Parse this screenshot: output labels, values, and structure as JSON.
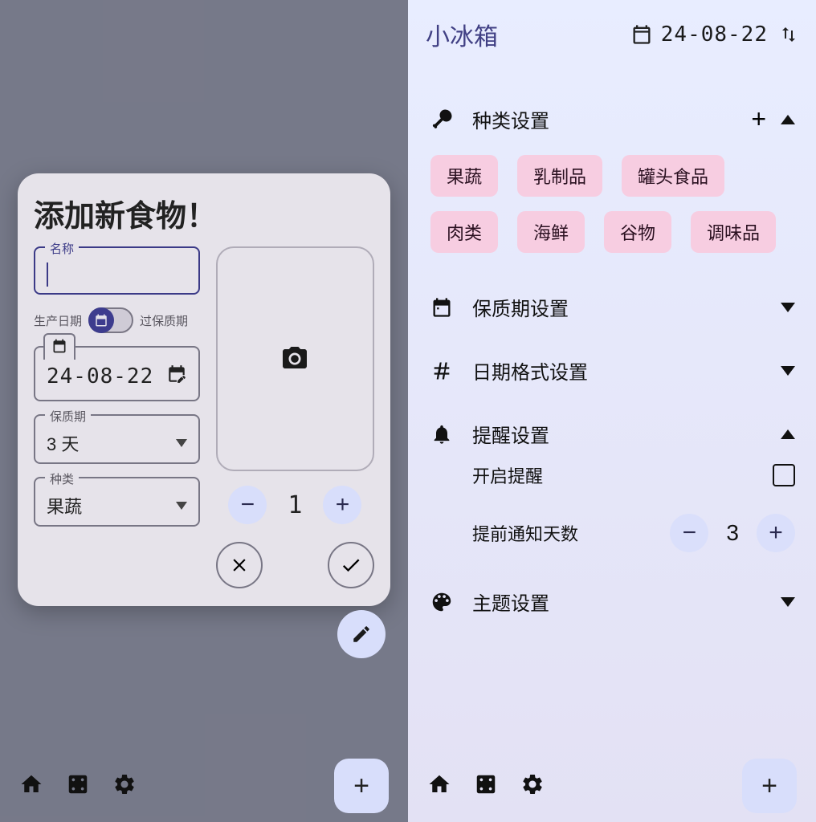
{
  "app_title": "小冰箱",
  "header_date": "24-08-22",
  "modal": {
    "title": "添加新食物！",
    "name_label": "名称",
    "name_value": "",
    "toggle_left": "生产日期",
    "toggle_right": "过保质期",
    "date_value": "24-08-22",
    "shelf_label": "保质期",
    "shelf_value": "3 天",
    "category_label": "种类",
    "category_value": "果蔬",
    "quantity": "1"
  },
  "settings": {
    "categories": {
      "title": "种类设置",
      "items": [
        "果蔬",
        "乳制品",
        "罐头食品",
        "肉类",
        "海鲜",
        "谷物",
        "调味品"
      ]
    },
    "shelf": {
      "title": "保质期设置"
    },
    "datefmt": {
      "title": "日期格式设置"
    },
    "reminder": {
      "title": "提醒设置",
      "enable_label": "开启提醒",
      "enable_checked": false,
      "advance_label": "提前通知天数",
      "advance_days": "3"
    },
    "theme": {
      "title": "主题设置"
    }
  }
}
